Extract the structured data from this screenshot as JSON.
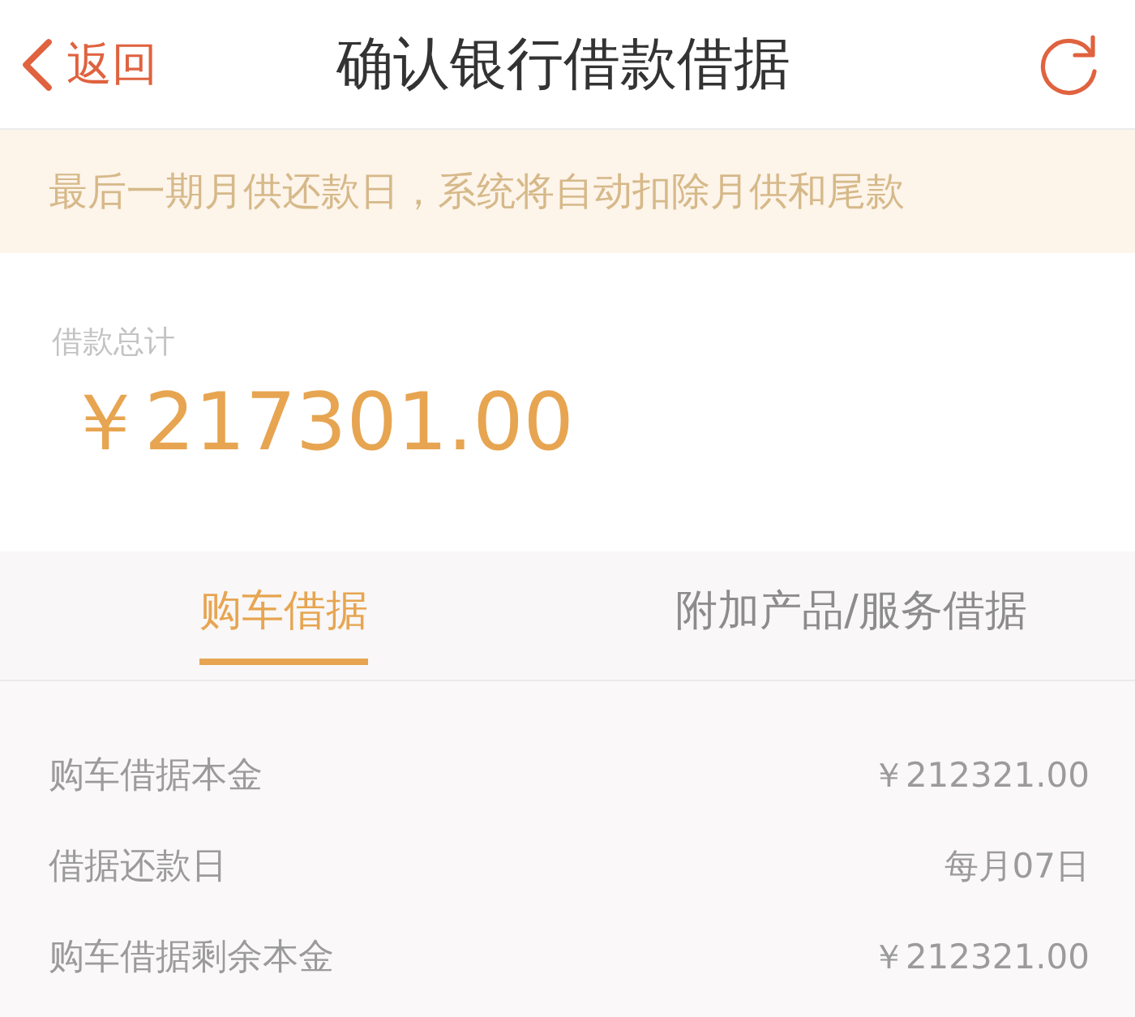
{
  "header": {
    "back": {
      "label": "返回"
    },
    "title": "确认银行借款借据"
  },
  "notice": "最后一期月供还款日，系统将自动扣除月供和尾款",
  "total": {
    "label": "借款总计",
    "amount": "￥217301.00"
  },
  "tabs": [
    {
      "label": "购车借据",
      "selected": true
    },
    {
      "label": "附加产品/服务借据",
      "selected": false
    }
  ],
  "details": [
    {
      "label": "购车借据本金",
      "value": "￥212321.00"
    },
    {
      "label": "借据还款日",
      "value": "每月07日"
    },
    {
      "label": "购车借据剩余本金",
      "value": "￥212321.00"
    }
  ]
}
